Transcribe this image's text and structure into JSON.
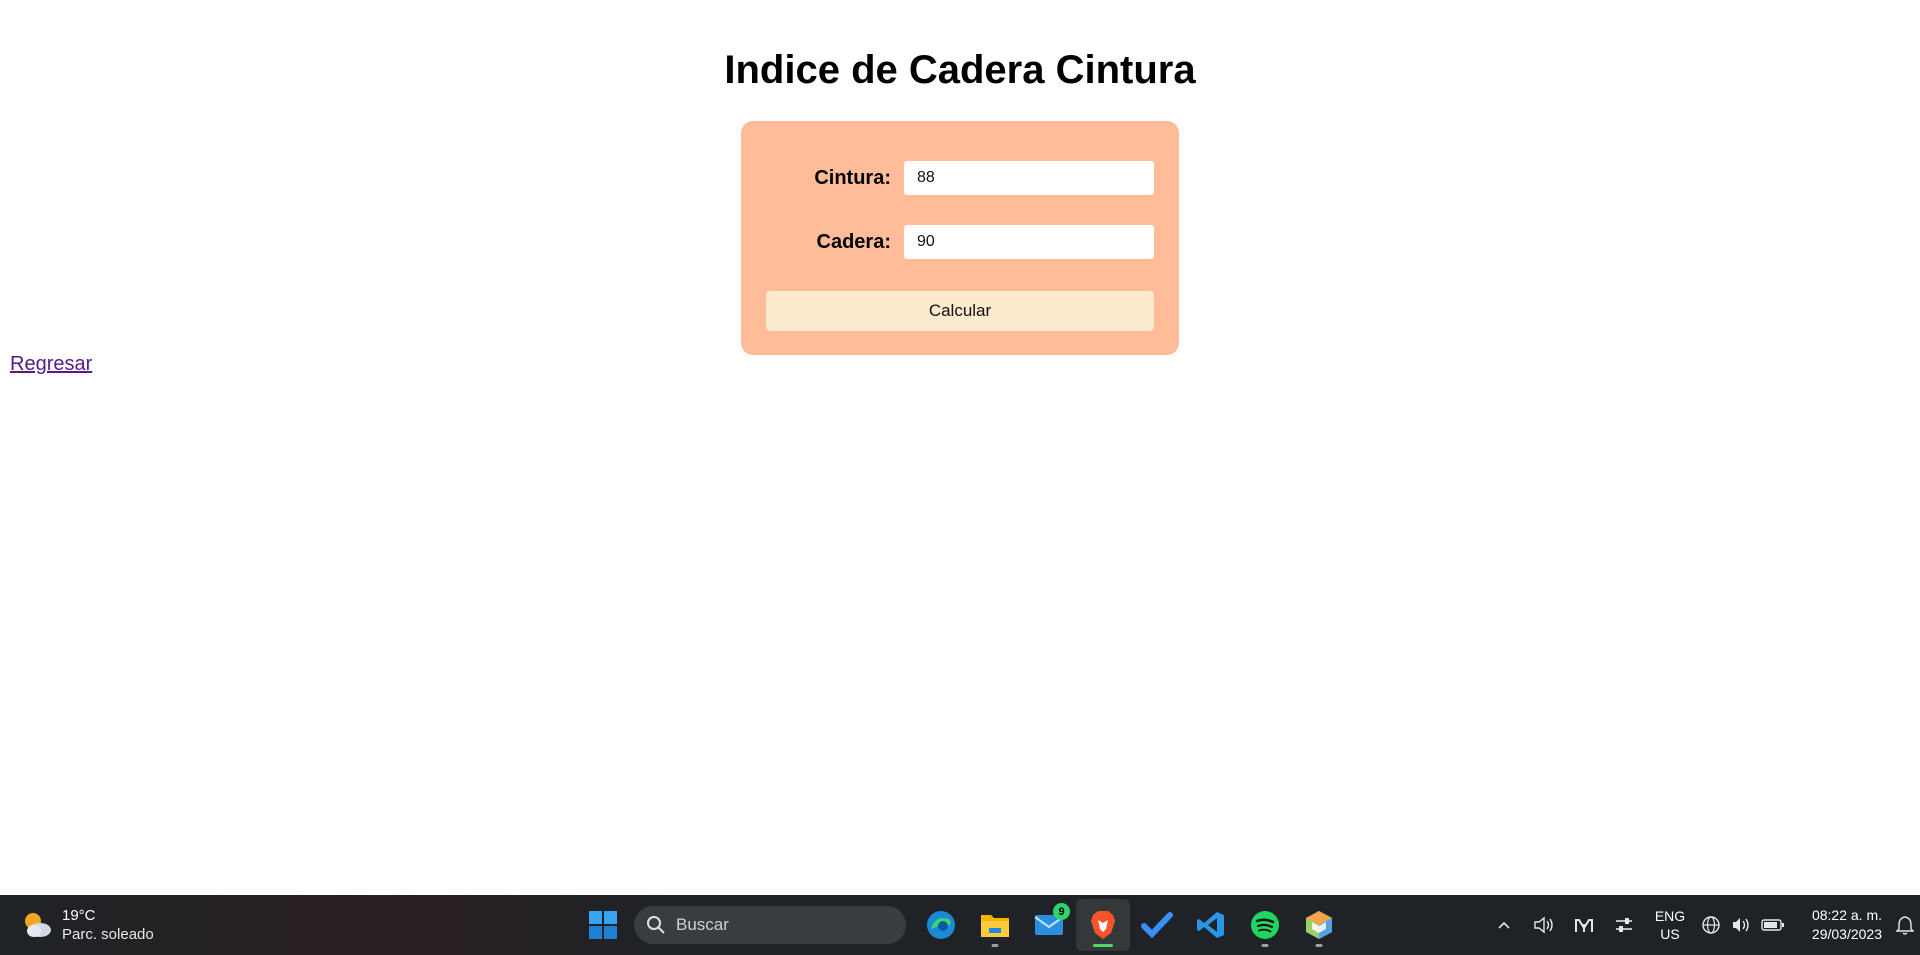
{
  "page": {
    "title": "Indice de Cadera Cintura",
    "back_link": "Regresar"
  },
  "form": {
    "cintura_label": "Cintura:",
    "cintura_value": "88",
    "cadera_label": "Cadera:",
    "cadera_value": "90",
    "submit_label": "Calcular"
  },
  "taskbar": {
    "weather": {
      "temp": "19°C",
      "description": "Parc. soleado",
      "icon": "partly-sunny-icon"
    },
    "search_placeholder": "Buscar",
    "apps": [
      {
        "name": "edge",
        "icon": "edge-icon"
      },
      {
        "name": "file-explorer",
        "icon": "folder-icon"
      },
      {
        "name": "mail",
        "icon": "mail-icon",
        "badge": "9"
      },
      {
        "name": "brave",
        "icon": "brave-icon"
      },
      {
        "name": "todo",
        "icon": "checkmark-icon"
      },
      {
        "name": "vscode",
        "icon": "vscode-icon"
      },
      {
        "name": "spotify",
        "icon": "spotify-icon"
      },
      {
        "name": "netbeans",
        "icon": "cube-icon"
      }
    ],
    "language": {
      "line1": "ENG",
      "line2": "US"
    },
    "clock": {
      "time": "08:22 a. m.",
      "date": "29/03/2023"
    }
  }
}
